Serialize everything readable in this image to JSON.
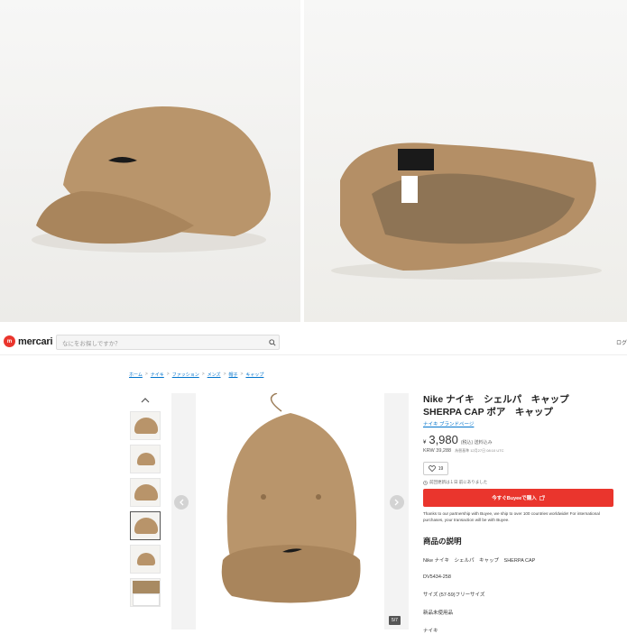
{
  "header": {
    "logo_text": "mercari",
    "logo_mark": "m",
    "search_placeholder": "なにをお探しですか？",
    "search_icon": "search-icon",
    "right_text": "ログ"
  },
  "breadcrumb": [
    "ホーム",
    "ナイキ",
    "ファッション",
    "メンズ",
    "帽子",
    "キャップ"
  ],
  "gallery": {
    "counter": "5/7",
    "prev_icon": "chevron-left-icon",
    "next_icon": "chevron-right-icon",
    "up_icon": "chevron-up-icon",
    "active_thumb": 4
  },
  "product": {
    "title": "Nike ナイキ　シェルパ　キャップ　SHERPA CAP ボア　キャップ",
    "brand_link": "ナイキ ブランドページ",
    "yen_symbol": "¥",
    "price": "3,980",
    "price_note": "(税込) 送料込み",
    "krw": "KRW 39,288",
    "krw_note": "為替基準 12月27日 08:10 UTC",
    "like_count": "19",
    "update_text": "前回更新は１日 前にありました",
    "buy_button_label": "今すぐBuyeeで購入",
    "buyee_note": "Thanks to our partnership with Buyee, we ship to over 100 countries worldwide! For international purchases, your transaction will be with Buyee."
  },
  "description": {
    "heading": "商品の説明",
    "lines": [
      "Nike ナイキ　シェルパ　キャップ　SHERPA CAP",
      "DV5434-258",
      "サイズ (57-59)フリーサイズ",
      "新品未使用品",
      "ナイキ"
    ]
  },
  "colors": {
    "brand_red": "#ea352d",
    "link_blue": "#0073cc",
    "cap_tan": "#b8946a"
  }
}
